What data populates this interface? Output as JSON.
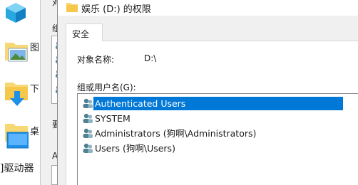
{
  "explorer": {
    "items": [
      {
        "icon": "cube-3d-icon",
        "label": ""
      },
      {
        "icon": "pictures-folder-icon",
        "label": "图"
      },
      {
        "icon": "downloads-folder-icon",
        "label": "下"
      },
      {
        "icon": "desktop-folder-icon",
        "label": "桌"
      }
    ],
    "bottom_label": "]驱动器"
  },
  "back_dialog": {
    "texts": [
      "对",
      "组",
      "要",
      "Au"
    ]
  },
  "dialog": {
    "title": "娱乐 (D:) 的权限",
    "tab_label": "安全",
    "object_name_label": "对象名称:",
    "object_name_value": "D:\\",
    "group_label": "组或用户名(G):",
    "users": [
      {
        "name": "Authenticated Users",
        "selected": true
      },
      {
        "name": "SYSTEM",
        "selected": false
      },
      {
        "name": "Administrators (狗啊\\Administrators)",
        "selected": false
      },
      {
        "name": "Users (狗啊\\Users)",
        "selected": false
      }
    ]
  },
  "colors": {
    "selection": "#0078d7",
    "folder": "#f8d775",
    "accent_blue": "#1e90e8"
  }
}
